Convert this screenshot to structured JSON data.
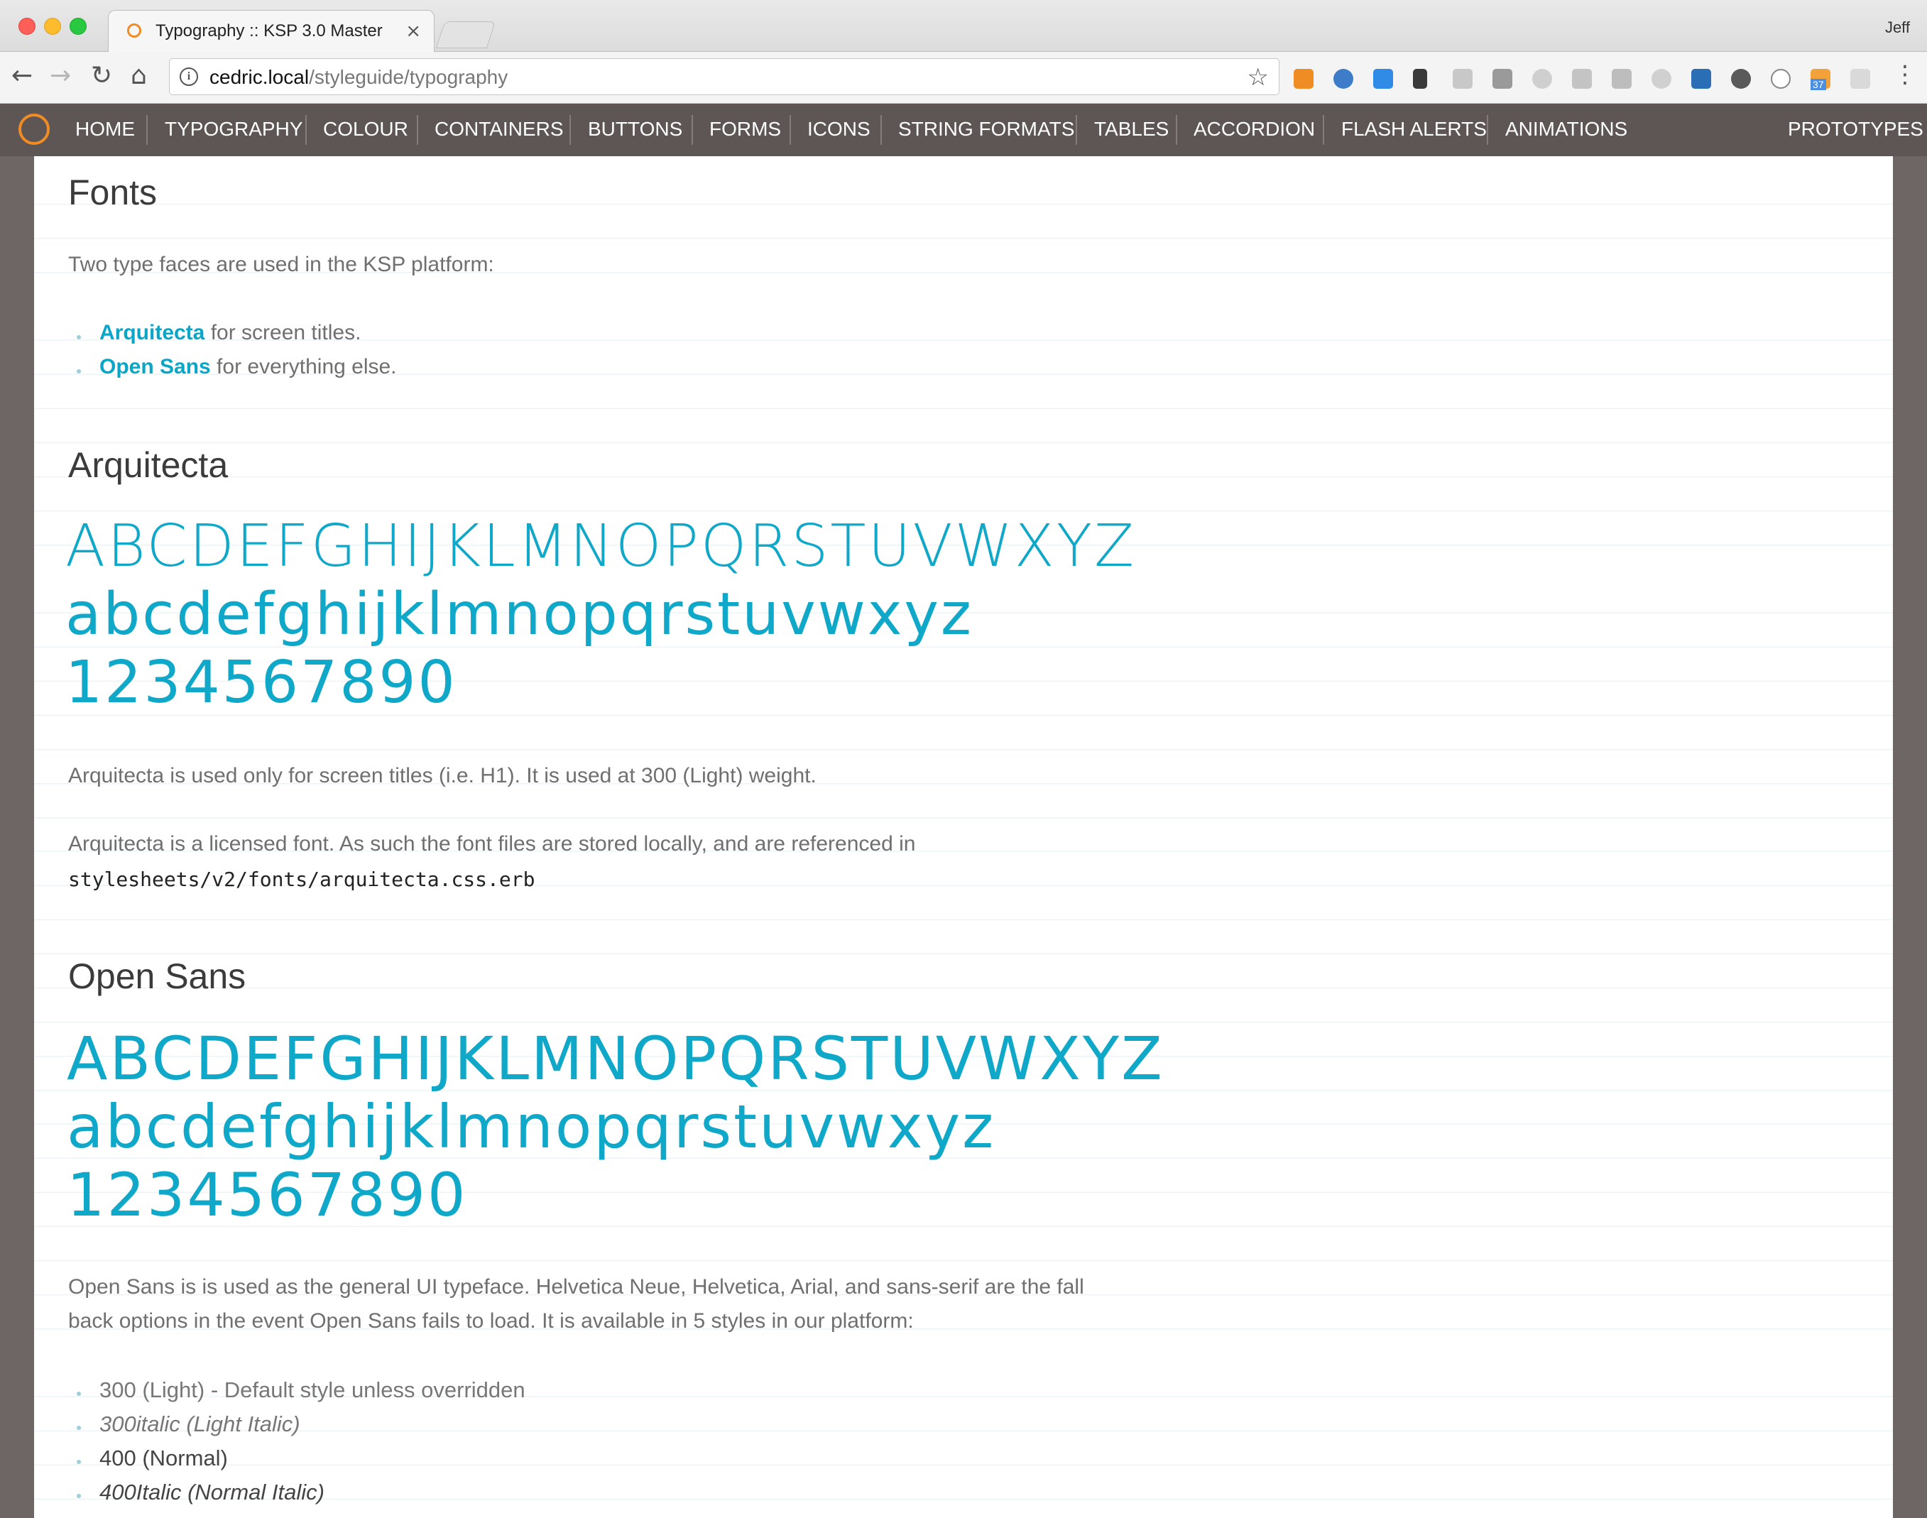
{
  "browser": {
    "tab_title": "Typography :: KSP 3.0 Master",
    "tab_close": "×",
    "user": "Jeff",
    "url_host": "cedric.local",
    "url_path": "/styleguide/typography",
    "nav_back": "←",
    "nav_forward": "→",
    "nav_reload": "↻",
    "nav_home": "⌂",
    "bookmark": "☆",
    "menu": "⋮",
    "extension_badge": "37"
  },
  "site_nav": {
    "items": [
      "HOME",
      "TYPOGRAPHY",
      "COLOUR",
      "CONTAINERS",
      "BUTTONS",
      "FORMS",
      "ICONS",
      "STRING FORMATS",
      "TABLES",
      "ACCORDION",
      "FLASH ALERTS",
      "ANIMATIONS"
    ],
    "right_item": "PROTOTYPES"
  },
  "fonts_section": {
    "heading": "Fonts",
    "intro": "Two type faces are used in the KSP platform:",
    "list": [
      {
        "name": "Arquitecta",
        "rest": " for screen titles."
      },
      {
        "name": "Open Sans",
        "rest": " for everything else."
      }
    ]
  },
  "arquitecta": {
    "heading": "Arquitecta",
    "upper": "ABCDEFGHIJKLMNOPQRSTUVWXYZ",
    "lower": "abcdefghijklmnopqrstuvwxyz",
    "digits": "1234567890",
    "usage": "Arquitecta is used only for screen titles (i.e. H1). It is used at 300 (Light) weight.",
    "license": "Arquitecta is a licensed font. As such the font files are stored locally, and are referenced in",
    "path": "stylesheets/v2/fonts/arquitecta.css.erb"
  },
  "open_sans": {
    "heading": "Open Sans",
    "upper": "ABCDEFGHIJKLMNOPQRSTUVWXYZ",
    "lower": "abcdefghijklmnopqrstuvwxyz",
    "digits": "1234567890",
    "desc_line1": "Open Sans is is used as the general UI typeface. Helvetica Neue, Helvetica, Arial, and sans-serif are the fall",
    "desc_line2": "back options in the event Open Sans fails to load. It is available in 5 styles in our platform:",
    "styles": [
      "300 (Light) - Default style unless overridden",
      "300italic (Light Italic)",
      "400 (Normal)",
      "400Italic (Normal Italic)"
    ]
  }
}
